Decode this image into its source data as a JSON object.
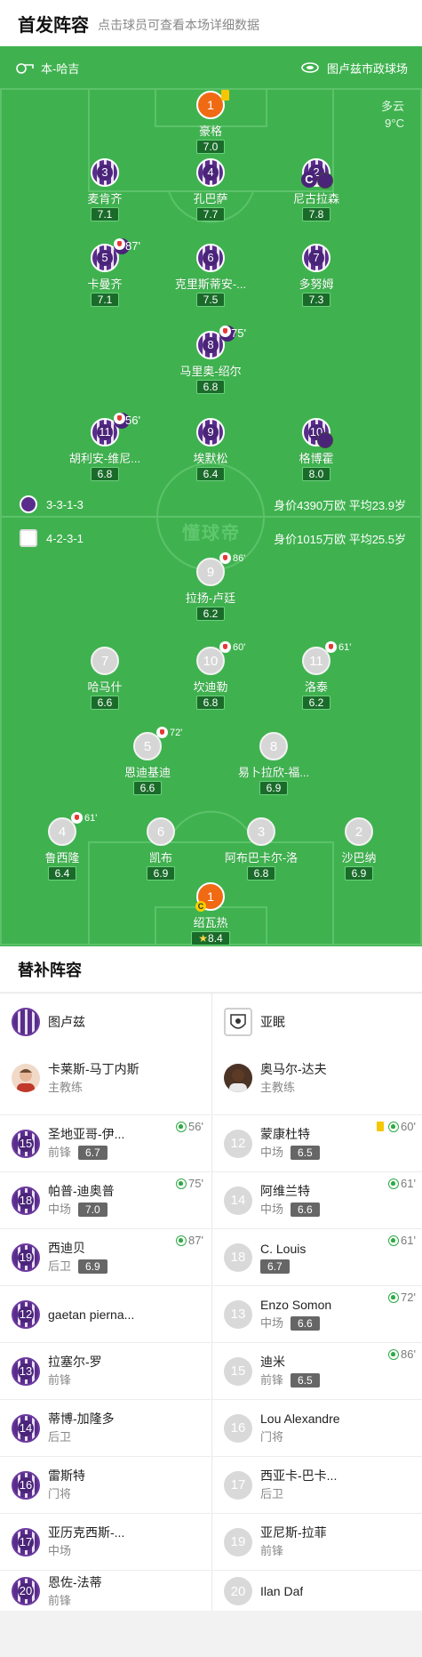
{
  "header": {
    "title": "首发阵容",
    "subtitle": "点击球员可查看本场详细数据"
  },
  "match": {
    "coach_label": "本-哈吉",
    "stadium": "图卢兹市政球场",
    "weather": "多云",
    "temperature": "9°C"
  },
  "home_team": {
    "formation": "3-3-1-3",
    "value_text": "身价4390万欧 平均23.9岁"
  },
  "away_team": {
    "formation": "4-2-3-1",
    "value_text": "身价1015万欧 平均25.5岁"
  },
  "watermark": "懂球帝",
  "home_players": [
    {
      "num": "1",
      "name": "豪格",
      "rating": "7.0"
    },
    {
      "num": "3",
      "name": "麦肯齐",
      "rating": "7.1"
    },
    {
      "num": "4",
      "name": "孔巴萨",
      "rating": "7.7"
    },
    {
      "num": "2",
      "name": "尼古拉森",
      "rating": "7.8"
    },
    {
      "num": "5",
      "name": "卡曼齐",
      "rating": "7.1",
      "sub": "87'"
    },
    {
      "num": "6",
      "name": "克里斯蒂安-...",
      "rating": "7.5"
    },
    {
      "num": "7",
      "name": "多努姆",
      "rating": "7.3"
    },
    {
      "num": "8",
      "name": "马里奥-绍尔",
      "rating": "6.8",
      "sub": "75'"
    },
    {
      "num": "11",
      "name": "胡利安-维尼...",
      "rating": "6.8",
      "sub": "56'"
    },
    {
      "num": "9",
      "name": "埃默松",
      "rating": "6.4"
    },
    {
      "num": "10",
      "name": "格博霍",
      "rating": "8.0"
    }
  ],
  "away_players": [
    {
      "num": "9",
      "name": "拉扬-卢廷",
      "rating": "6.2",
      "sub": "86'"
    },
    {
      "num": "7",
      "name": "哈马什",
      "rating": "6.6"
    },
    {
      "num": "10",
      "name": "坎迪勒",
      "rating": "6.8",
      "sub": "60'"
    },
    {
      "num": "11",
      "name": "洛泰",
      "rating": "6.2",
      "sub": "61'"
    },
    {
      "num": "5",
      "name": "恩迪基迪",
      "rating": "6.6",
      "sub": "72'"
    },
    {
      "num": "8",
      "name": "易卜拉欣-福...",
      "rating": "6.9"
    },
    {
      "num": "4",
      "name": "鲁西隆",
      "rating": "6.4",
      "sub": "61'"
    },
    {
      "num": "6",
      "name": "凯布",
      "rating": "6.9"
    },
    {
      "num": "3",
      "name": "阿布巴卡尔-洛",
      "rating": "6.8"
    },
    {
      "num": "2",
      "name": "沙巴纳",
      "rating": "6.9"
    },
    {
      "num": "1",
      "name": "绍瓦热",
      "rating": "8.4"
    }
  ],
  "bench": {
    "title": "替补阵容",
    "left": {
      "team": "图卢兹",
      "coach": {
        "name": "卡莱斯-马丁内斯",
        "role": "主教练"
      },
      "players": [
        {
          "num": "15",
          "name": "圣地亚哥-伊...",
          "pos": "前锋",
          "rating": "6.7",
          "in": "56'"
        },
        {
          "num": "18",
          "name": "帕普-迪奥普",
          "pos": "中场",
          "rating": "7.0",
          "in": "75'"
        },
        {
          "num": "19",
          "name": "西迪贝",
          "pos": "后卫",
          "rating": "6.9",
          "in": "87'"
        },
        {
          "num": "12",
          "name": "gaetan pierna...",
          "pos": ""
        },
        {
          "num": "13",
          "name": "拉塞尔-罗",
          "pos": "前锋"
        },
        {
          "num": "14",
          "name": "蒂博-加隆多",
          "pos": "后卫"
        },
        {
          "num": "16",
          "name": "雷斯特",
          "pos": "门将"
        },
        {
          "num": "17",
          "name": "亚历克西斯-...",
          "pos": "中场"
        },
        {
          "num": "20",
          "name": "恩佐-法蒂",
          "pos": "前锋"
        }
      ]
    },
    "right": {
      "team": "亚眠",
      "coach": {
        "name": "奥马尔-达夫",
        "role": "主教练"
      },
      "players": [
        {
          "num": "12",
          "name": "蒙康杜特",
          "pos": "中场",
          "rating": "6.5",
          "in": "60'"
        },
        {
          "num": "14",
          "name": "阿维兰特",
          "pos": "中场",
          "rating": "6.6",
          "in": "61'"
        },
        {
          "num": "18",
          "name": "C. Louis",
          "pos": "",
          "rating": "6.7",
          "in": "61'"
        },
        {
          "num": "13",
          "name": "Enzo Somon",
          "pos": "中场",
          "rating": "6.6",
          "in": "72'"
        },
        {
          "num": "15",
          "name": "迪米",
          "pos": "前锋",
          "rating": "6.5",
          "in": "86'"
        },
        {
          "num": "16",
          "name": "Lou Alexandre",
          "pos": "门将"
        },
        {
          "num": "17",
          "name": "西亚卡-巴卡...",
          "pos": "后卫"
        },
        {
          "num": "19",
          "name": "亚尼斯-拉菲",
          "pos": "前锋"
        },
        {
          "num": "20",
          "name": "Ilan Daf",
          "pos": ""
        }
      ]
    }
  },
  "colors": {
    "pitch": "#3fb24f",
    "home": "#5a2d8c",
    "gk": "#f06a14",
    "sub_in": "#2eaa45"
  }
}
